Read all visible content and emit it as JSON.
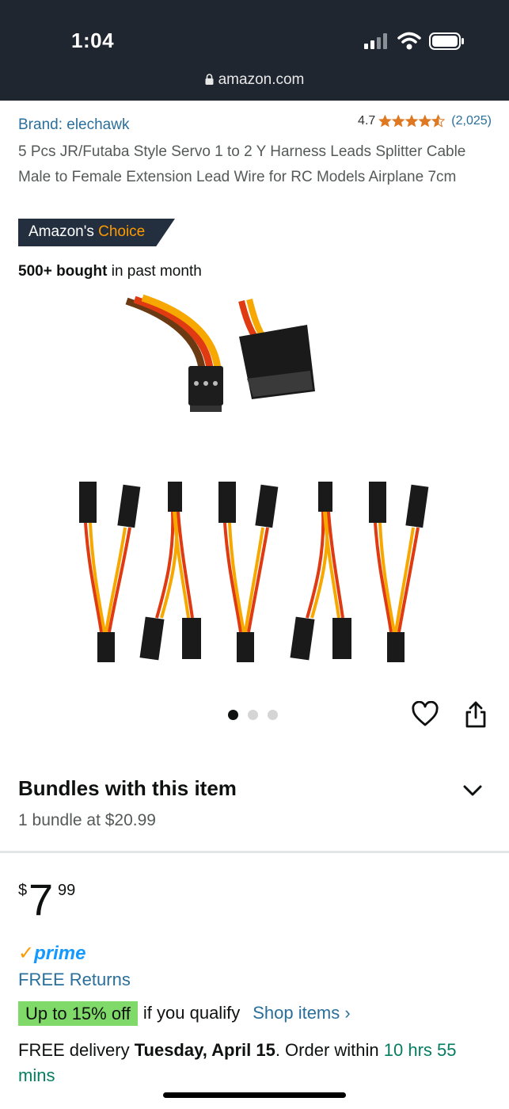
{
  "status_bar": {
    "time": "1:04",
    "url": "amazon.com"
  },
  "product": {
    "brand": "Brand: elechawk",
    "rating_value": "4.7",
    "rating_count": "(2,025)",
    "title": "5 Pcs JR/Futaba Style Servo 1 to 2 Y Harness Leads Splitter Cable Male to Female Extension Lead Wire for RC Models Airplane 7cm",
    "badge_prefix": "Amazon's",
    "badge_suffix": "Choice",
    "bought_bold": "500+ bought",
    "bought_rest": "in past month"
  },
  "gallery": {
    "image_count": 3,
    "active_index": 0
  },
  "bundles": {
    "title": "Bundles with this item",
    "subtitle": "1 bundle at $20.99"
  },
  "pricing": {
    "symbol": "$",
    "whole": "7",
    "fraction": "99"
  },
  "prime": {
    "label": "prime"
  },
  "free_returns": "FREE Returns",
  "offer": {
    "badge": "Up to 15% off",
    "text": "if you qualify",
    "link": "Shop items ›"
  },
  "delivery": {
    "prefix": "FREE delivery",
    "date": "Tuesday, April 15",
    "middle": ". Order within",
    "countdown": "10 hrs 55 mins"
  },
  "colors": {
    "link": "#2a6f9b",
    "star": "#de7921",
    "badge_bg": "#232f3e",
    "offer_green": "#7fda69",
    "prime_blue": "#1399ff"
  }
}
